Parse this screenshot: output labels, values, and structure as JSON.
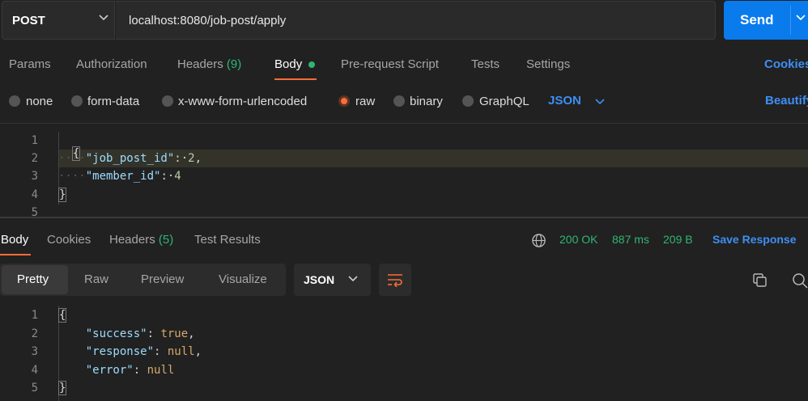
{
  "request": {
    "method": "POST",
    "url": "localhost:8080/job-post/apply",
    "send_label": "Send"
  },
  "request_tabs": {
    "params": "Params",
    "authorization": "Authorization",
    "headers": "Headers",
    "headers_count": "(9)",
    "body": "Body",
    "pre_request": "Pre-request Script",
    "tests": "Tests",
    "settings": "Settings",
    "cookies": "Cookies"
  },
  "body_types": {
    "none": "none",
    "form_data": "form-data",
    "urlencoded": "x-www-form-urlencoded",
    "raw": "raw",
    "binary": "binary",
    "graphql": "GraphQL",
    "selected": "raw",
    "format": "JSON",
    "beautify": "Beautify"
  },
  "request_body": {
    "line_numbers": [
      "1",
      "2",
      "3",
      "4",
      "5"
    ],
    "open_brace": "{",
    "close_brace": "}",
    "key1": "\"job_post_id\"",
    "val1": "2",
    "key2": "\"member_id\"",
    "val2": "4"
  },
  "response_tabs": {
    "body": "Body",
    "cookies": "Cookies",
    "headers": "Headers",
    "headers_count": "(5)",
    "test_results": "Test Results"
  },
  "response_status": {
    "status": "200 OK",
    "time": "887 ms",
    "size": "209 B",
    "save": "Save Response"
  },
  "response_view": {
    "pretty": "Pretty",
    "raw": "Raw",
    "preview": "Preview",
    "visualize": "Visualize",
    "format": "JSON"
  },
  "response_body": {
    "line_numbers": [
      "1",
      "2",
      "3",
      "4",
      "5"
    ],
    "open_brace": "{",
    "close_brace": "}",
    "key1": "\"success\"",
    "val1": "true",
    "key2": "\"response\"",
    "val2": "null",
    "key3": "\"error\"",
    "val3": "null"
  },
  "icons": {
    "method_dropdown": "chevron-down-icon",
    "send_dropdown": "chevron-down-icon",
    "format_dropdown": "chevron-down-icon",
    "globe": "globe-icon",
    "wrap": "wrap-lines-icon",
    "copy": "copy-icon",
    "search": "search-icon"
  },
  "colors": {
    "accent_orange": "#ff6c37",
    "send_blue": "#097bed",
    "link_blue": "#3d8ff5",
    "success_green": "#2fb673"
  }
}
